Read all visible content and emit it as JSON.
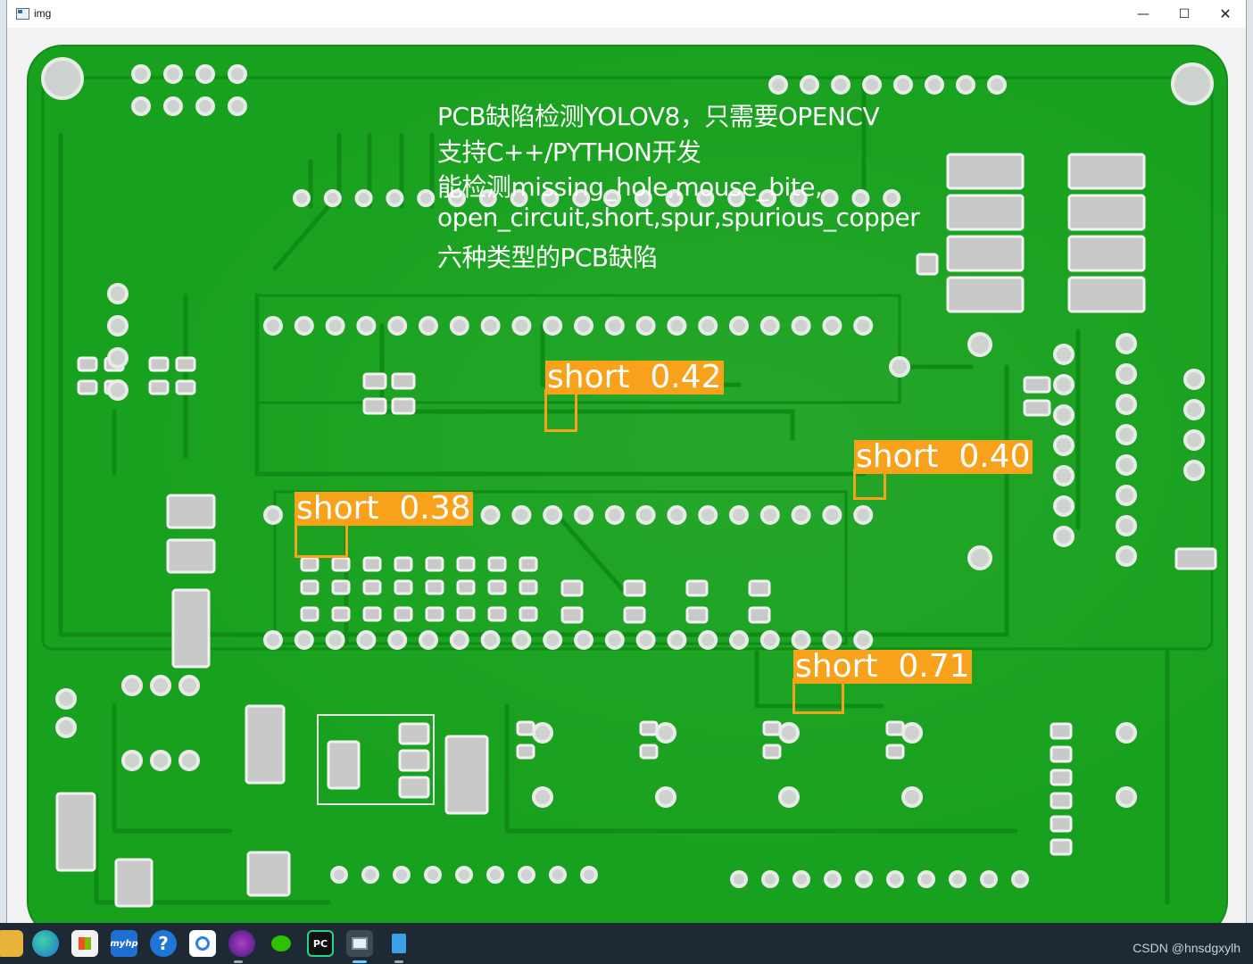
{
  "window": {
    "title": "img",
    "minimize_glyph": "—",
    "maximize_glyph": "☐",
    "close_glyph": "✕"
  },
  "overlay_text": [
    "PCB缺陷检测YOLOV8，只需要OPENCV",
    "支持C++/PYTHON开发",
    "能检测missing_hole,mouse_bite,",
    "open_circuit,short,spur,spurious_copper",
    "六种类型的PCB缺陷"
  ],
  "detections": [
    {
      "label": "short  0.42",
      "class": "short",
      "confidence": 0.42
    },
    {
      "label": "short  0.40",
      "class": "short",
      "confidence": 0.4
    },
    {
      "label": "short  0.38",
      "class": "short",
      "confidence": 0.38
    },
    {
      "label": "short  0.71",
      "class": "short",
      "confidence": 0.71
    }
  ],
  "colors": {
    "detection": "#f7a21a",
    "board": "#18a11e",
    "taskbar": "#1e2a33"
  },
  "taskbar": {
    "icons": [
      {
        "name": "file-explorer-icon",
        "glyph": ""
      },
      {
        "name": "edge-icon",
        "glyph": ""
      },
      {
        "name": "microsoft-store-icon",
        "glyph": ""
      },
      {
        "name": "myhp-icon",
        "glyph": "myhp"
      },
      {
        "name": "help-icon",
        "glyph": "?"
      },
      {
        "name": "baidu-netdisk-icon",
        "glyph": ""
      },
      {
        "name": "media-app-icon",
        "glyph": ""
      },
      {
        "name": "wechat-icon",
        "glyph": ""
      },
      {
        "name": "pycharm-icon",
        "glyph": "PC"
      },
      {
        "name": "image-viewer-icon",
        "glyph": ""
      },
      {
        "name": "notepad-icon",
        "glyph": ""
      }
    ],
    "watermark": "CSDN @hnsdgxylh"
  }
}
